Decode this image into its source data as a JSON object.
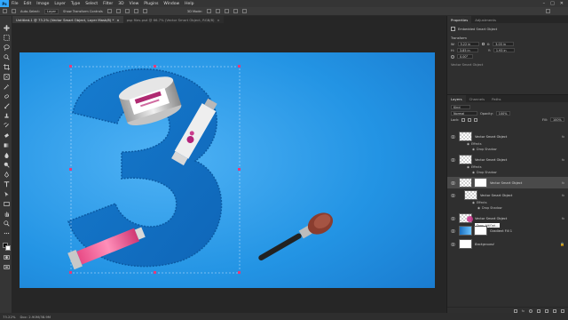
{
  "app": {
    "logo": "Ps"
  },
  "menu": [
    "File",
    "Edit",
    "Image",
    "Layer",
    "Type",
    "Select",
    "Filter",
    "3D",
    "View",
    "Plugins",
    "Window",
    "Help"
  ],
  "window_controls": {
    "minimize": "–",
    "maximize": "□",
    "close": "✕"
  },
  "options_bar": {
    "auto_select_label": "Auto-Select:",
    "auto_select_value": "Layer",
    "show_transform": "Show Transform Controls",
    "mode_3d": "3D Mode:"
  },
  "doc_tabs": [
    {
      "label": "Untitled-1 @ 73.2% (Vector Smart Object, Layer Mask/8) *",
      "close": "×"
    },
    {
      "label": "psp files.psd @ 66.7% (Vector Smart Object, RGB/8)",
      "close": "×"
    }
  ],
  "status": {
    "zoom": "73.22%",
    "doc_size": "Doc: 2.90M/38.9M"
  },
  "panels": {
    "properties_tab": "Properties",
    "adjustments_tab": "Adjustments",
    "object_type": "Embedded Smart Object",
    "transform_label": "Transform",
    "w_label": "W:",
    "w_value": "5.22 in",
    "x_label": "X:",
    "x_value": "3.03 in",
    "h_label": "H:",
    "h_value": "3.85 in",
    "y_label": "Y:",
    "y_value": "1.93 in",
    "angle_value": "0.00°",
    "object_name": "Vector Smart Object",
    "layers_tab": "Layers",
    "channels_tab": "Channels",
    "paths_tab": "Paths",
    "kind_label": "Kind",
    "blend_mode": "Normal",
    "opacity_label": "Opacity:",
    "opacity_value": "100%",
    "lock_label": "Lock:",
    "fill_label": "Fill:",
    "fill_value": "100%"
  },
  "layers": [
    {
      "name": "Vector Smart Object",
      "fx": "fx"
    },
    {
      "name": "Effects",
      "sub": true
    },
    {
      "name": "Drop Shadow",
      "sub": true
    },
    {
      "name": "Vector Smart Object",
      "fx": "fx"
    },
    {
      "name": "Effects",
      "sub": true
    },
    {
      "name": "Drop Shadow",
      "sub": true
    },
    {
      "name": "Vector Smart Object",
      "fx": "fx"
    },
    {
      "name": "Vector Smart Object",
      "fx": "fx"
    },
    {
      "name": "Effects",
      "sub": true
    },
    {
      "name": "Drop Shadow",
      "sub": true
    },
    {
      "name": "Vector Smart Object",
      "fx": "fx"
    },
    {
      "name": "Gradient Fill 1"
    },
    {
      "name": "Background"
    }
  ],
  "drag_tooltip": "Drop, Alt/Opt...",
  "colors": {
    "accent": "#31a8ff",
    "canvas_blue": "#1f8fe0",
    "panel": "#2f2f2f"
  }
}
